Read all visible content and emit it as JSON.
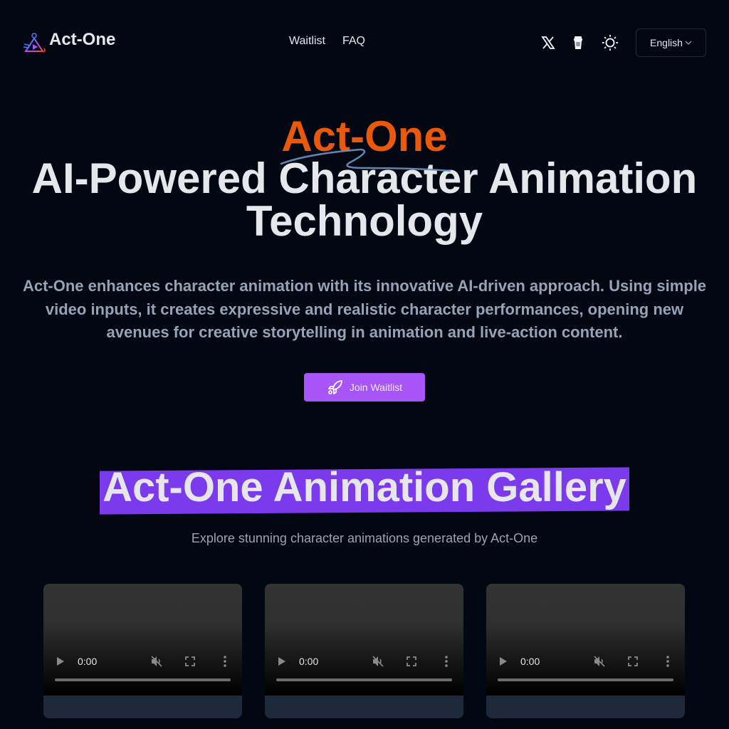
{
  "header": {
    "brand": "Act-One",
    "nav": [
      {
        "label": "Waitlist"
      },
      {
        "label": "FAQ"
      }
    ],
    "icons": [
      "x-twitter-icon",
      "coffee-cup-icon",
      "sun-icon"
    ],
    "language": {
      "selected": "English"
    }
  },
  "hero": {
    "brand": "Act-One",
    "title_line1": "AI-Powered Character Animation",
    "title_line2": "Technology",
    "description": "Act-One enhances character animation with its innovative AI-driven approach. Using simple video inputs, it creates expressive and realistic character performances, opening new avenues for creative storytelling in animation and live-action content.",
    "cta_label": "Join Waitlist",
    "colors": {
      "brand": "#ea580c",
      "cta": "#a855f7"
    }
  },
  "gallery": {
    "title": "Act-One Animation Gallery",
    "subtitle": "Explore stunning character animations generated by Act-One",
    "highlight_color": "#7c3aed",
    "videos": [
      {
        "time": "0:00"
      },
      {
        "time": "0:00"
      },
      {
        "time": "0:00"
      }
    ]
  }
}
